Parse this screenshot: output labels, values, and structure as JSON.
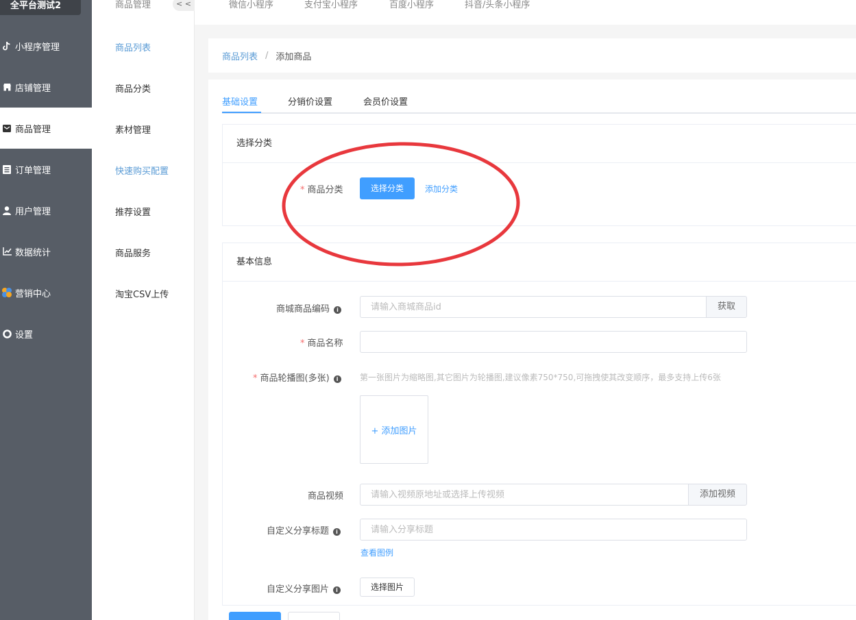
{
  "app": {
    "brand": "全平台测试2"
  },
  "sidebar": {
    "items": [
      {
        "label": "小程序管理",
        "icon": "tiktok-icon"
      },
      {
        "label": "店铺管理",
        "icon": "store-icon"
      },
      {
        "label": "商品管理",
        "icon": "mail-icon",
        "active": true
      },
      {
        "label": "订单管理",
        "icon": "list-icon"
      },
      {
        "label": "用户管理",
        "icon": "user-icon"
      },
      {
        "label": "数据统计",
        "icon": "chart-line-icon"
      },
      {
        "label": "营销中心",
        "icon": "marketing-icon"
      },
      {
        "label": "设置",
        "icon": "gear-icon"
      }
    ]
  },
  "submenu": {
    "header": "商品管理",
    "collapse": "< <",
    "items": [
      {
        "label": "商品列表"
      },
      {
        "label": "商品分类"
      },
      {
        "label": "素材管理"
      },
      {
        "label": "快速购买配置"
      },
      {
        "label": "推荐设置"
      },
      {
        "label": "商品服务"
      },
      {
        "label": "淘宝CSV上传"
      }
    ]
  },
  "topbar": {
    "tabs": [
      {
        "label": "微信小程序"
      },
      {
        "label": "支付宝小程序"
      },
      {
        "label": "百度小程序"
      },
      {
        "label": "抖音/头条小程序"
      }
    ]
  },
  "breadcrumb": {
    "parent": "商品列表",
    "separator": "/",
    "current": "添加商品"
  },
  "tabs": [
    {
      "label": "基础设置",
      "active": true
    },
    {
      "label": "分销价设置"
    },
    {
      "label": "会员价设置"
    }
  ],
  "category_card": {
    "title": "选择分类",
    "label": "商品分类",
    "select_button": "选择分类",
    "add_link": "添加分类"
  },
  "basic_card": {
    "title": "基本信息",
    "code": {
      "label": "商城商品编码",
      "placeholder": "请输入商城商品id",
      "button": "获取"
    },
    "name": {
      "label": "商品名称",
      "value": ""
    },
    "carousel": {
      "label": "商品轮播图(多张)",
      "hint": "第一张图片为缩略图,其它图片为轮播图,建议像素750*750,可拖拽使其改变顺序，最多支持上传6张",
      "add_label": "+ 添加图片"
    },
    "video": {
      "label": "商品视频",
      "placeholder": "请输入视频原地址或选择上传视频",
      "button": "添加视频"
    },
    "share_title": {
      "label": "自定义分享标题",
      "placeholder": "请输入分享标题",
      "example_link": "查看图例"
    },
    "share_image": {
      "label": "自定义分享图片",
      "button": "选择图片"
    }
  },
  "colors": {
    "accent": "#409eff",
    "sidebar_bg": "#575d66",
    "annotation": "#e8383d"
  }
}
